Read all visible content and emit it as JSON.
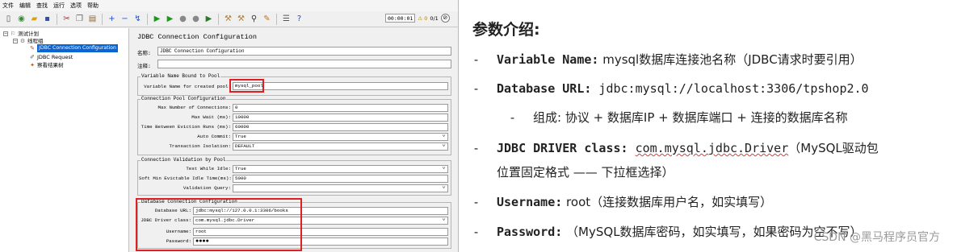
{
  "jmeter": {
    "menu": [
      "文件",
      "编辑",
      "查找",
      "运行",
      "选项",
      "帮助"
    ],
    "timer": "00:00:01",
    "warnings": "⚠ 0",
    "threads": "0/1",
    "tree": {
      "root": "测试计划",
      "thread_group": "线程组",
      "selected": "JDBC Connection Configuration",
      "request": "JDBC Request",
      "listener": "察看结果树"
    },
    "panel": {
      "title": "JDBC Connection Configuration",
      "name_label": "名称:",
      "name_value": "JDBC Connection Configuration",
      "comment_label": "注释:",
      "comment_value": "",
      "pool_bound": {
        "legend": "Variable Name Bound to Pool",
        "var_label": "Variable Name for created pool:",
        "var_value": "mysql_pool"
      },
      "pool_config": {
        "legend": "Connection Pool Configuration",
        "fields": [
          {
            "label": "Max Number of Connections:",
            "value": "0"
          },
          {
            "label": "Max Wait (ms):",
            "value": "10000"
          },
          {
            "label": "Time Between Eviction Runs (ms):",
            "value": "60000"
          },
          {
            "label": "Auto Commit:",
            "value": "True"
          },
          {
            "label": "Transaction Isolation:",
            "value": "DEFAULT"
          }
        ]
      },
      "validation": {
        "legend": "Connection Validation by Pool",
        "fields": [
          {
            "label": "Test While Idle:",
            "value": "True"
          },
          {
            "label": "Soft Min Evictable Idle Time(ms):",
            "value": "5000"
          },
          {
            "label": "Validation Query:",
            "value": ""
          }
        ]
      },
      "db_config": {
        "legend": "Database Connection Configuration",
        "fields": [
          {
            "label": "Database URL:",
            "value": "jdbc:mysql://127.0.0.1:3306/books"
          },
          {
            "label": "JDBC Driver class:",
            "value": "com.mysql.jdbc.Driver"
          },
          {
            "label": "Username:",
            "value": "root"
          },
          {
            "label": "Password:",
            "value": "●●●●"
          }
        ]
      }
    }
  },
  "doc": {
    "title": "参数介绍:",
    "items": [
      {
        "dash": "-",
        "key": "Variable Name:",
        "rest": " mysql数据库连接池名称（JDBC请求时要引用）"
      },
      {
        "dash": "-",
        "key": "Database URL:",
        "rest": " jdbc:mysql://localhost:3306/tpshop2.0"
      },
      {
        "dash": "-",
        "rest": "组成: 协议 + 数据库IP + 数据库端口 + 连接的数据库名称"
      },
      {
        "dash": "-",
        "key": "JDBC DRIVER class:",
        "mid": " ",
        "wavy": "com.mysql.jdbc.Driver",
        "rest": "（MySQL驱动包"
      },
      {
        "rest": "位置固定格式 —— 下拉框选择）"
      },
      {
        "dash": "-",
        "key": "Username:",
        "rest": " root（连接数据库用户名，如实填写）"
      },
      {
        "dash": "-",
        "key": "Password:",
        "rest": " （MySQL数据库密码，如实填写，如果密码为空不写）"
      }
    ],
    "watermark": "CSDN @黑马程序员官方"
  }
}
